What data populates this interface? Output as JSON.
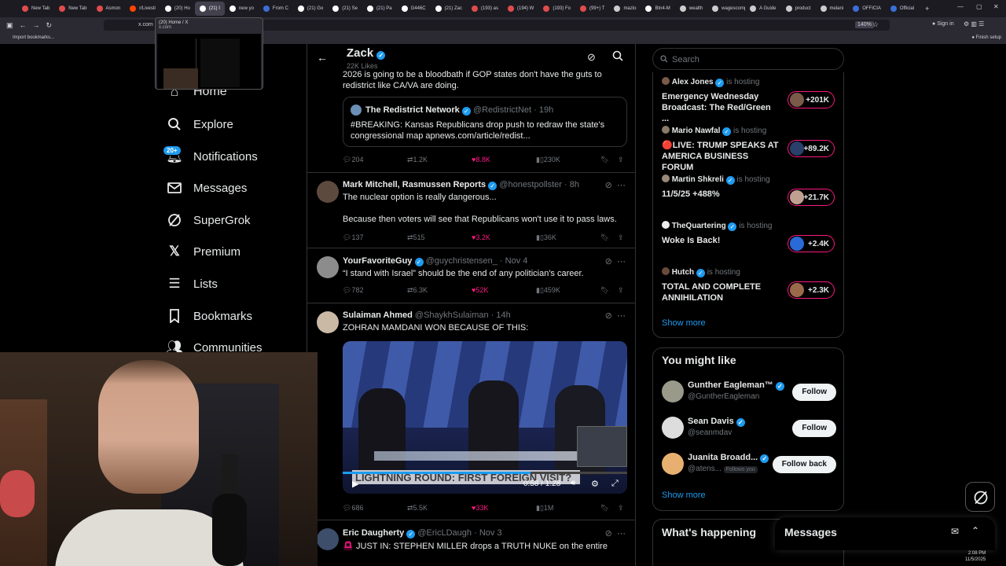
{
  "browser": {
    "tabs": [
      {
        "label": "New Tab",
        "color": "#e04c4c"
      },
      {
        "label": "New Tab",
        "color": "#e04c4c"
      },
      {
        "label": "Asmon",
        "color": "#e04c4c"
      },
      {
        "label": "r/Livesti",
        "color": "#ff4500"
      },
      {
        "label": "(20) Ho",
        "color": "#ffffff"
      },
      {
        "label": "(21) I",
        "color": "#ffffff",
        "active": true
      },
      {
        "label": "new yo",
        "color": "#ffffff"
      },
      {
        "label": "From C",
        "color": "#3a6fd8"
      },
      {
        "label": "(21) Go",
        "color": "#ffffff"
      },
      {
        "label": "(21) Se",
        "color": "#ffffff"
      },
      {
        "label": "(21) Pa",
        "color": "#ffffff"
      },
      {
        "label": "G446C",
        "color": "#ffffff"
      },
      {
        "label": "(21) Zac",
        "color": "#ffffff"
      },
      {
        "label": "(193) as",
        "color": "#e04c4c"
      },
      {
        "label": "(194) W",
        "color": "#e04c4c"
      },
      {
        "label": "(193) Fo",
        "color": "#e04c4c"
      },
      {
        "label": "(99+) T",
        "color": "#e04c4c"
      },
      {
        "label": "mazlo",
        "color": "#cccccc"
      },
      {
        "label": "Btn4-M",
        "color": "#ffffff"
      },
      {
        "label": "wealth",
        "color": "#cccccc"
      },
      {
        "label": "wagescomp",
        "color": "#cccccc"
      },
      {
        "label": "A Guide",
        "color": "#cccccc"
      },
      {
        "label": "product",
        "color": "#cccccc"
      },
      {
        "label": "melani",
        "color": "#cccccc"
      },
      {
        "label": "OFFICIA",
        "color": "#3a6fd8"
      },
      {
        "label": "Official",
        "color": "#3a6fd8"
      }
    ],
    "url": "x.com",
    "zoom": "140%",
    "sign_in": "Sign in",
    "finish_setup": "Finish setup",
    "import_bookmarks": "Import bookmarks...",
    "tab_preview": {
      "title": "(20) Home / X",
      "url": "x.com"
    }
  },
  "nav": {
    "home": "Home",
    "explore": "Explore",
    "notifications": "Notifications",
    "notifications_badge": "20+",
    "messages": "Messages",
    "supergrok": "SuperGrok",
    "premium": "Premium",
    "lists": "Lists",
    "bookmarks": "Bookmarks",
    "communities": "Communities"
  },
  "profile_header": {
    "name": "Zack",
    "likes": "22K Likes"
  },
  "posts": [
    {
      "partial_text": "2026 is going to be a bloodbath if GOP states don't have the guts to redistrict like CA/VA are doing.",
      "quote": {
        "name": "The Redistrict Network",
        "handle": "@RedistrictNet",
        "time": "19h",
        "text": "#BREAKING: Kansas Republicans drop push to redraw the state's congressional map apnews.com/article/redist..."
      },
      "replies": "204",
      "reposts": "1.2K",
      "likes": "8.8K",
      "views": "230K"
    },
    {
      "name": "Mark Mitchell, Rasmussen Reports",
      "handle": "@honestpollster",
      "time": "8h",
      "text": "The nuclear option is really dangerous...",
      "text2": "Because then voters will see that Republicans won't use it to pass laws.",
      "replies": "137",
      "reposts": "515",
      "likes": "3.2K",
      "views": "36K"
    },
    {
      "name": "YourFavoriteGuy",
      "handle": "@guychristensen_",
      "time": "Nov 4",
      "text": "“I stand with Israel” should be the end of any politician's career.",
      "replies": "782",
      "reposts": "6.3K",
      "likes": "52K",
      "views": "459K"
    },
    {
      "name": "Sulaiman Ahmed",
      "handle": "@ShaykhSulaiman",
      "time": "14h",
      "text": "ZOHRAN MAMDANI WON BECAUSE OF THIS:",
      "video_caption": "LIGHTNING ROUND: FIRST FOREIGN VISIT?",
      "video_time": "0:58 / 1:28",
      "replies": "686",
      "reposts": "5.5K",
      "likes": "33K",
      "views": "1M"
    },
    {
      "name": "Eric Daugherty",
      "handle": "@EricLDaugh",
      "time": "Nov 3",
      "text": "JUST IN: STEPHEN MILLER drops a TRUTH NUKE on the entire"
    }
  ],
  "search": {
    "placeholder": "Search"
  },
  "spaces": [
    {
      "host": "Alex Jones",
      "status": "is hosting",
      "title": "Emergency Wednesday Broadcast: The Red/Green ...",
      "listeners": "+201K"
    },
    {
      "host": "Mario Nawfal",
      "status": "is hosting",
      "title": "🔴LIVE: TRUMP SPEAKS AT AMERICA BUSINESS FORUM",
      "listeners": "+89.2K"
    },
    {
      "host": "Martin Shkreli",
      "status": "is hosting",
      "title": "11/5/25 +488%",
      "listeners": "+21.7K"
    },
    {
      "host": "TheQuartering",
      "status": "is hosting",
      "title": "Woke Is Back!",
      "listeners": "+2.4K"
    },
    {
      "host": "Hutch",
      "status": "is hosting",
      "title": "TOTAL AND COMPLETE ANNIHILATION",
      "listeners": "+2.3K"
    }
  ],
  "spaces_show_more": "Show more",
  "you_might_like": {
    "title": "You might like",
    "accounts": [
      {
        "name": "Gunther Eagleman™",
        "handle": "@GuntherEagleman",
        "button": "Follow"
      },
      {
        "name": "Sean Davis",
        "handle": "@seanmdav",
        "button": "Follow"
      },
      {
        "name": "Juanita Broadd...",
        "handle": "@atens...",
        "follows_you": "Follows you",
        "button": "Follow back"
      }
    ],
    "show_more": "Show more"
  },
  "whats_happening": "What's happening",
  "messages_drawer": "Messages",
  "taskbar": {
    "time": "2:08 PM",
    "date": "11/5/2025"
  }
}
